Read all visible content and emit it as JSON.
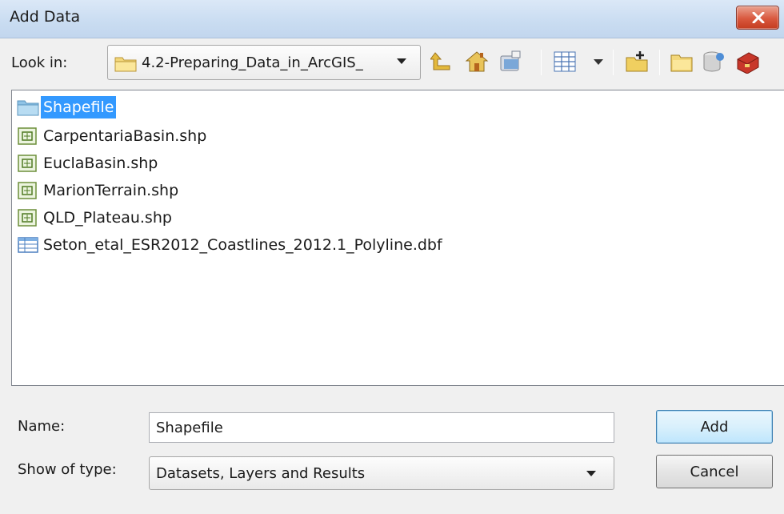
{
  "window": {
    "title": "Add Data"
  },
  "toolbar": {
    "look_in_label": "Look in:",
    "look_in_value": "4.2-Preparing_Data_in_ArcGIS_",
    "icons": [
      "up-one-level-icon",
      "home-icon",
      "connect-folder-icon",
      "list-view-icon",
      "new-folder-icon",
      "folder-connections-icon",
      "database-icon",
      "toolbox-icon"
    ]
  },
  "files": [
    {
      "label": "Shapefile",
      "type": "folder",
      "selected": true
    },
    {
      "label": "CarpentariaBasin.shp",
      "type": "shapefile"
    },
    {
      "label": "EuclaBasin.shp",
      "type": "shapefile"
    },
    {
      "label": "MarionTerrain.shp",
      "type": "shapefile"
    },
    {
      "label": "QLD_Plateau.shp",
      "type": "shapefile"
    },
    {
      "label": "Seton_etal_ESR2012_Coastlines_2012.1_Polyline.dbf",
      "type": "table"
    }
  ],
  "form": {
    "name_label": "Name:",
    "name_value": "Shapefile",
    "type_label": "Show of type:",
    "type_value": "Datasets, Layers and Results"
  },
  "buttons": {
    "add": "Add",
    "cancel": "Cancel"
  },
  "colors": {
    "selection": "#3399ff",
    "titlebar": "#c9dcf1",
    "close_button": "#d9583e"
  }
}
